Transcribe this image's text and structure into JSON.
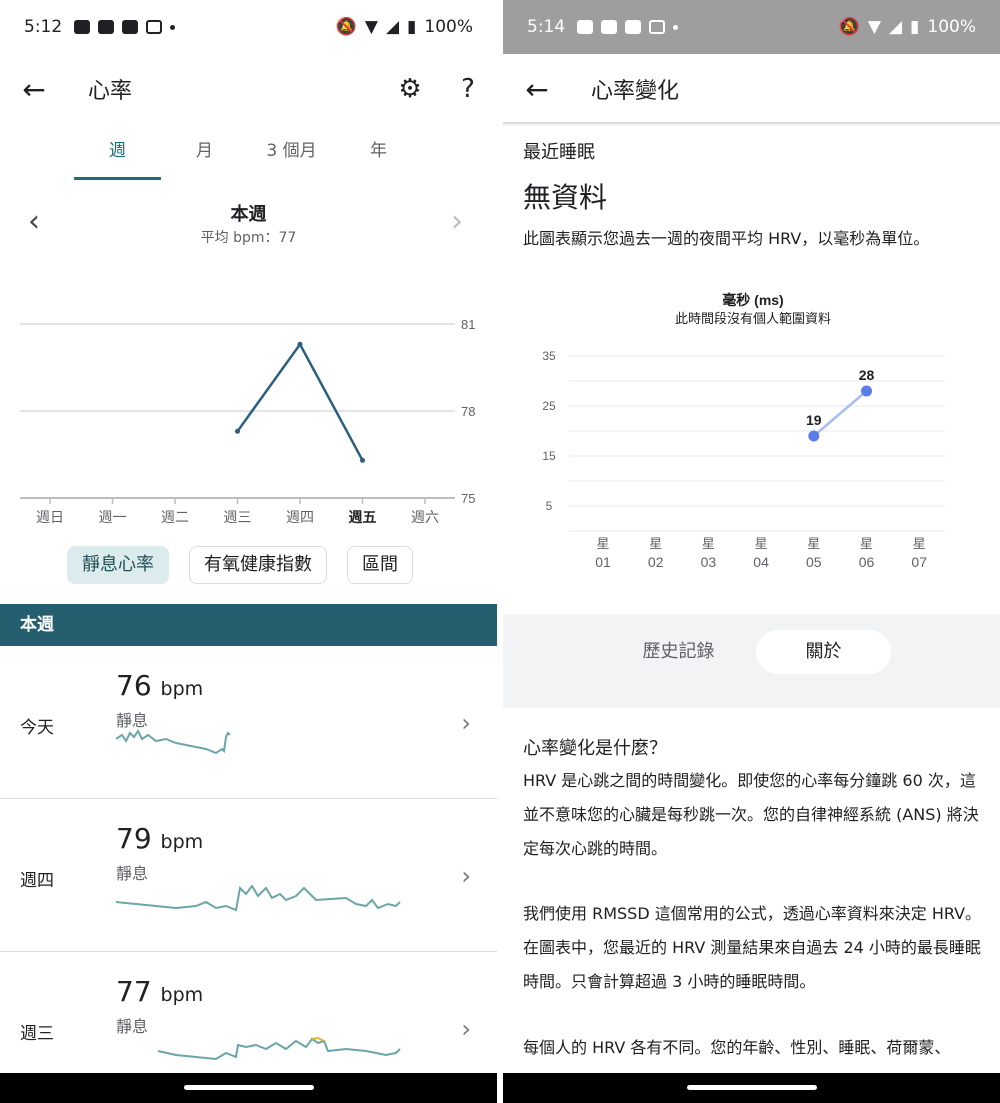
{
  "left": {
    "status": {
      "time": "5:12",
      "battery": "100%"
    },
    "appbar": {
      "back": "←",
      "title": "心率",
      "help": "?"
    },
    "tabs": [
      "週",
      "月",
      "3 個月",
      "年"
    ],
    "week": {
      "title": "本週",
      "subtitle": "平均 bpm：77",
      "prev": "‹",
      "next": "›"
    },
    "chart_data": {
      "type": "line",
      "categories": [
        "週日",
        "週一",
        "週二",
        "週三",
        "週四",
        "週五",
        "週六"
      ],
      "highlight_category": "週五",
      "values": [
        null,
        null,
        null,
        77.3,
        80.3,
        76.3,
        null
      ],
      "yticks": [
        "81",
        "78",
        "75"
      ],
      "ylim": [
        75,
        81
      ],
      "color": "#2a5f80"
    },
    "chips": [
      "靜息心率",
      "有氧健康指數",
      "區間"
    ],
    "list_header": "本週",
    "rows": [
      {
        "day": "今天",
        "value": "76",
        "unit": "bpm",
        "label": "靜息"
      },
      {
        "day": "週四",
        "value": "79",
        "unit": "bpm",
        "label": "靜息"
      },
      {
        "day": "週三",
        "value": "77",
        "unit": "bpm",
        "label": "靜息"
      }
    ]
  },
  "right": {
    "status": {
      "time": "5:14",
      "battery": "100%"
    },
    "appbar": {
      "back": "←",
      "title": "心率變化"
    },
    "recent_label": "最近睡眠",
    "nodata": "無資料",
    "desc": "此圖表顯示您過去一週的夜間平均 HRV，以毫秒為單位。",
    "chart_data": {
      "type": "line",
      "title": "毫秒 (ms)",
      "subtitle": "此時間段沒有個人範圍資料",
      "categories": [
        "01",
        "02",
        "03",
        "04",
        "05",
        "06",
        "07"
      ],
      "category_prefix": "星",
      "values": [
        null,
        null,
        null,
        null,
        19,
        28,
        null
      ],
      "data_labels": [
        "",
        "",
        "",
        "",
        "19",
        "28",
        ""
      ],
      "yticks": [
        "35",
        "25",
        "15",
        "5"
      ],
      "ylim": [
        5,
        35
      ],
      "color": "#5b7de6"
    },
    "segments": [
      "歷史記錄",
      "關於"
    ],
    "about_title": "心率變化是什麼？",
    "paragraphs": [
      "HRV 是心跳之間的時間變化。即使您的心率每分鐘跳 60 次，這並不意味您的心臟是每秒跳一次。您的自律神經系統 (ANS) 將決定每次心跳的時間。",
      "我們使用 RMSSD 這個常用的公式，透過心率資料來決定 HRV。在圖表中，您最近的 HRV 測量結果來自過去 24 小時的最長睡眠時間。只會計算超過 3 小時的睡眠時間。",
      "每個人的 HRV 各有不同。您的年齡、性別、睡眠、荷爾蒙、"
    ]
  }
}
